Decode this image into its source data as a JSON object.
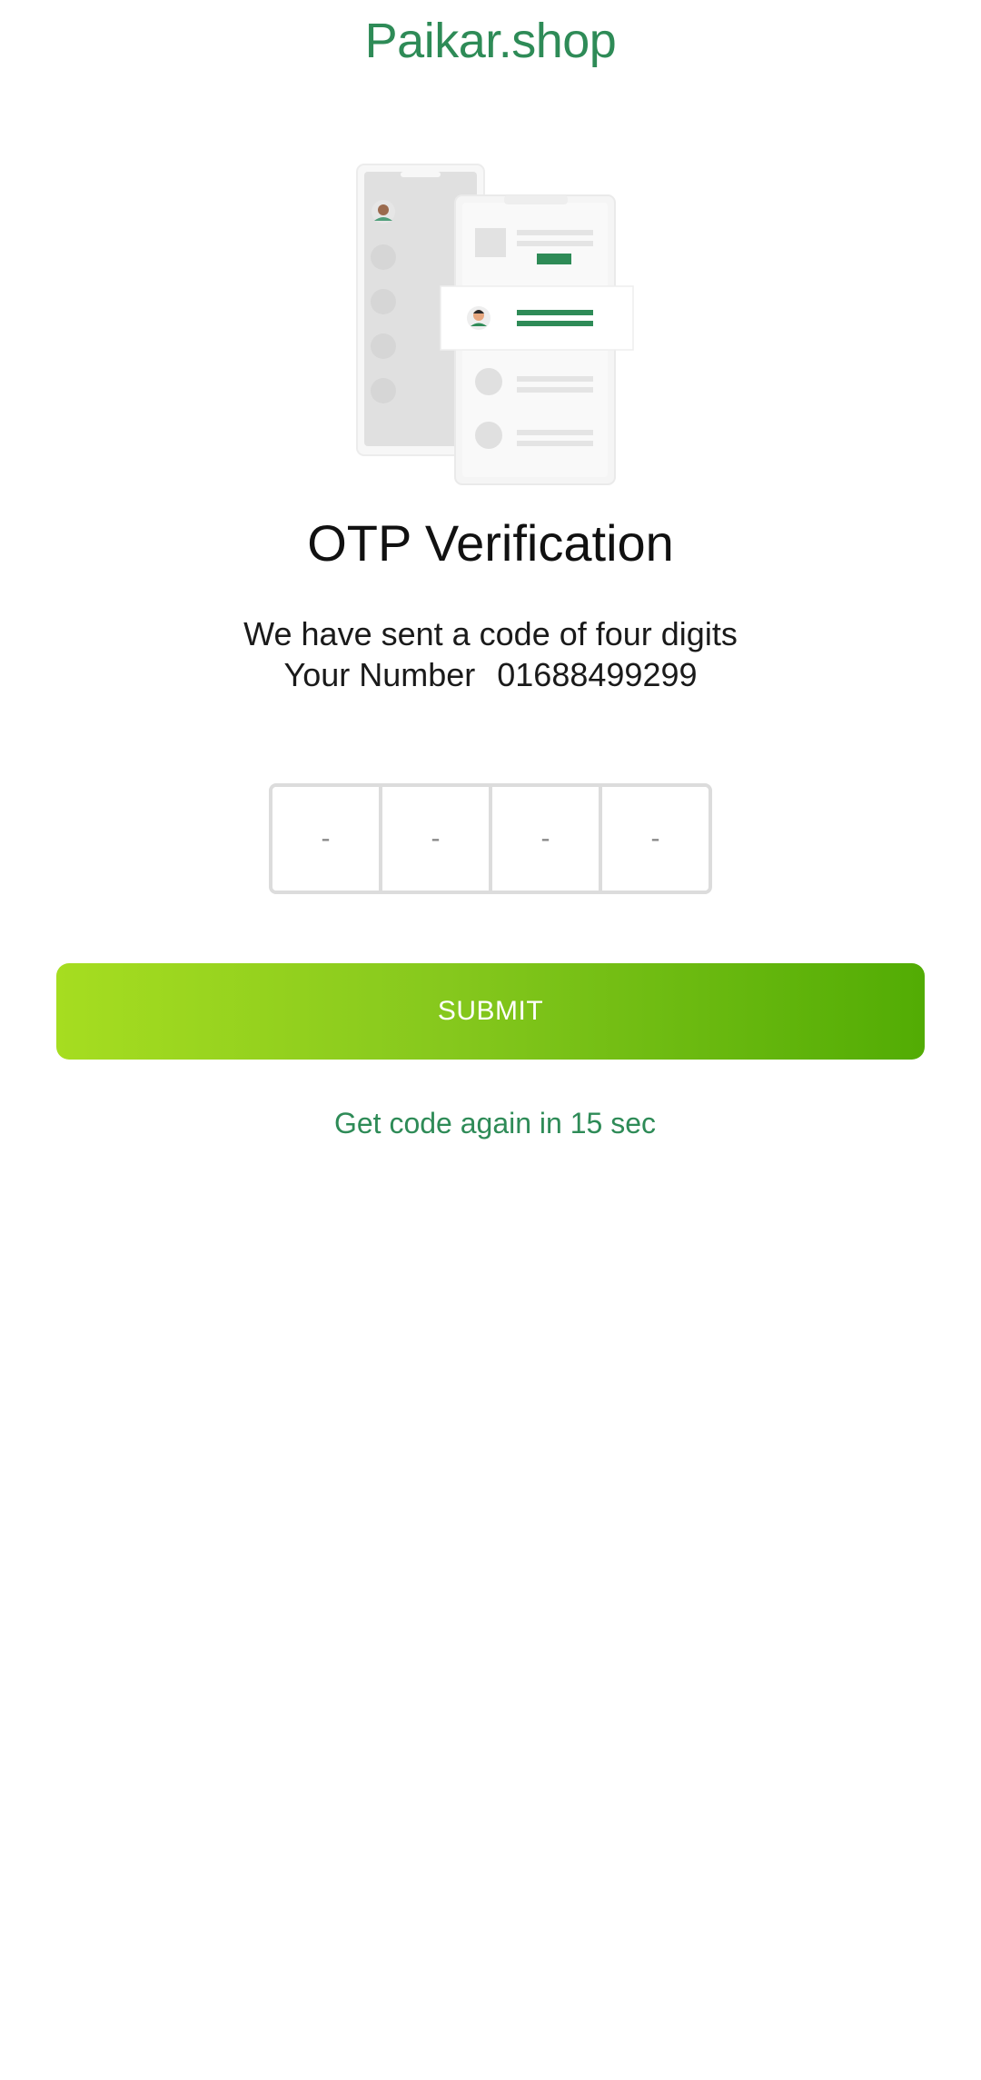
{
  "header": {
    "brand": "Paikar.shop"
  },
  "illustration": {
    "icon": "otp-phones-illustration"
  },
  "verification": {
    "title": "OTP Verification",
    "message": "We have sent a code of four digits",
    "number_label": "Your Number",
    "phone_number": "01688499299"
  },
  "otp": {
    "placeholders": [
      "-",
      "-",
      "-",
      "-"
    ]
  },
  "actions": {
    "submit_label": "SUBMIT",
    "resend_text": "Get code again in 15 sec"
  },
  "colors": {
    "brand_green": "#2e8b57",
    "button_gradient_start": "#a6dd20",
    "button_gradient_end": "#52ac04",
    "otp_border": "#dcdcdc"
  }
}
